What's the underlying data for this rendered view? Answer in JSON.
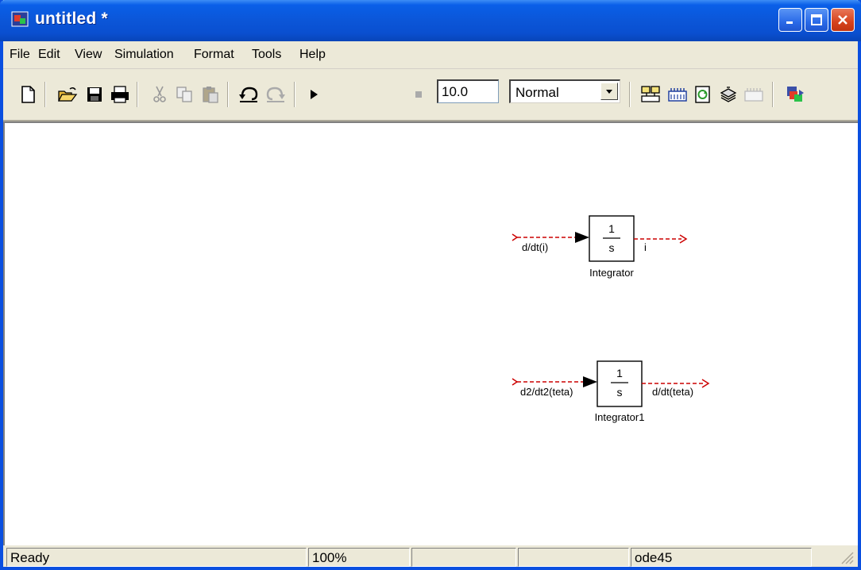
{
  "window": {
    "title": "untitled *"
  },
  "menu": [
    "File",
    "Edit",
    "View",
    "Simulation",
    "Format",
    "Tools",
    "Help"
  ],
  "toolbar": {
    "icons": [
      "new-model-icon",
      "open-icon",
      "save-icon",
      "print-icon",
      "cut-icon",
      "copy-icon",
      "paste-icon",
      "undo-icon",
      "redo-icon",
      "start-simulation-icon",
      "stop-simulation-icon",
      "build-icon",
      "library-browser-icon",
      "update-diagram-icon",
      "model-explorer-icon",
      "debug-icon",
      "toggle-icon"
    ],
    "stop_time": "10.0",
    "sim_mode": "Normal"
  },
  "diagram": {
    "blocks": [
      {
        "name": "Integrator",
        "numerator": "1",
        "denominator": "s",
        "input_label": "d/dt(i)",
        "output_label": "i"
      },
      {
        "name": "Integrator1",
        "numerator": "1",
        "denominator": "s",
        "input_label": "d2/dt2(teta)",
        "output_label": "d/dt(teta)"
      }
    ]
  },
  "status": {
    "text": "Ready",
    "zoom": "100%",
    "cell3": "",
    "cell4": "",
    "solver": "ode45"
  },
  "colors": {
    "titlebar": "#0a56d8",
    "unconnected_line": "#cc0000",
    "close_button": "#d6421c"
  }
}
